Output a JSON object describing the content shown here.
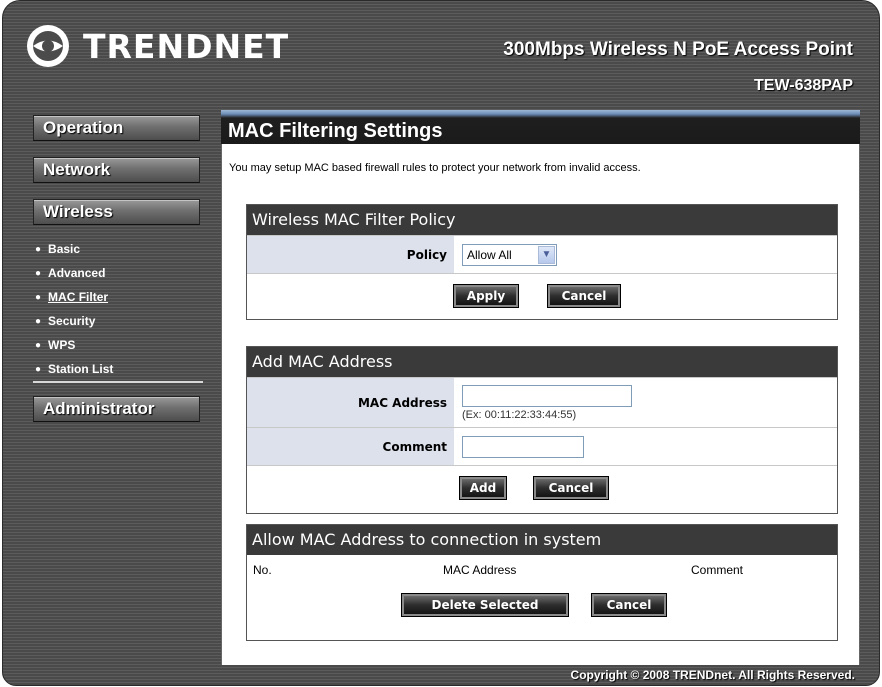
{
  "brand": {
    "name": "TRENDNET"
  },
  "header": {
    "product_title": "300Mbps Wireless N PoE Access Point",
    "model": "TEW-638PAP"
  },
  "sidebar": {
    "menus": {
      "operation": "Operation",
      "network": "Network",
      "wireless": "Wireless",
      "administrator": "Administrator"
    },
    "wireless_items": [
      {
        "label": "Basic",
        "active": false
      },
      {
        "label": "Advanced",
        "active": false
      },
      {
        "label": "MAC Filter",
        "active": true
      },
      {
        "label": "Security",
        "active": false
      },
      {
        "label": "WPS",
        "active": false
      },
      {
        "label": "Station List",
        "active": false
      }
    ]
  },
  "main": {
    "title": "MAC Filtering Settings",
    "intro": "You may setup MAC based firewall rules to protect your network from invalid access.",
    "policy_section": {
      "heading": "Wireless MAC Filter Policy",
      "policy_label": "Policy",
      "policy_value": "Allow All",
      "apply_label": "Apply",
      "cancel_label": "Cancel"
    },
    "add_section": {
      "heading": "Add MAC Address",
      "mac_label": "MAC Address",
      "mac_value": "",
      "mac_hint": "(Ex: 00:11:22:33:44:55)",
      "comment_label": "Comment",
      "comment_value": "",
      "add_label": "Add",
      "cancel_label": "Cancel"
    },
    "list_section": {
      "heading": "Allow MAC Address to connection in system",
      "columns": [
        "No.",
        "MAC Address",
        "Comment"
      ],
      "delete_label": "Delete Selected",
      "cancel_label": "Cancel"
    }
  },
  "footer": {
    "copyright": "Copyright © 2008 TRENDnet. All Rights Reserved."
  },
  "colors": {
    "accent_blue": "#6d8db8",
    "section_header": "#3a3a3a",
    "label_bg": "#dde1ec"
  }
}
